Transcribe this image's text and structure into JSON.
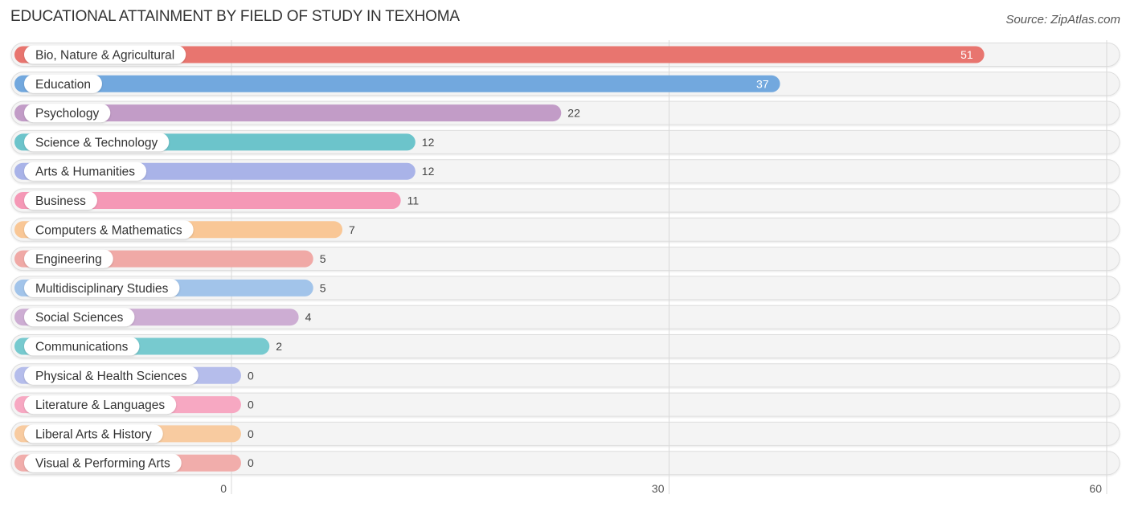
{
  "chart_data": {
    "type": "bar",
    "orientation": "horizontal",
    "title": "EDUCATIONAL ATTAINMENT BY FIELD OF STUDY IN TEXHOMA",
    "source": "Source: ZipAtlas.com",
    "xlabel": "",
    "ylabel": "",
    "xlim": [
      0,
      60
    ],
    "xticks": [
      0,
      30,
      60
    ],
    "xtick_labels": [
      "0",
      "30",
      "60"
    ],
    "grid": true,
    "legend": "none",
    "categories": [
      "Bio, Nature & Agricultural",
      "Education",
      "Psychology",
      "Science & Technology",
      "Arts & Humanities",
      "Business",
      "Computers & Mathematics",
      "Engineering",
      "Multidisciplinary Studies",
      "Social Sciences",
      "Communications",
      "Physical & Health Sciences",
      "Literature & Languages",
      "Liberal Arts & History",
      "Visual & Performing Arts"
    ],
    "values": [
      51,
      37,
      22,
      12,
      12,
      11,
      7,
      5,
      5,
      4,
      2,
      0,
      0,
      0,
      0
    ],
    "value_labels": [
      "51",
      "37",
      "22",
      "12",
      "12",
      "11",
      "7",
      "5",
      "5",
      "4",
      "2",
      "0",
      "0",
      "0",
      "0"
    ],
    "colors": [
      "#e8756f",
      "#72a8de",
      "#c29cc7",
      "#6cc4cb",
      "#a9b3e8",
      "#f598b6",
      "#f9c796",
      "#f0a9a6",
      "#a2c4ea",
      "#cdadd3",
      "#77cacf",
      "#b5bdeb",
      "#f7a8c2",
      "#f8cba0",
      "#f1adab"
    ]
  }
}
